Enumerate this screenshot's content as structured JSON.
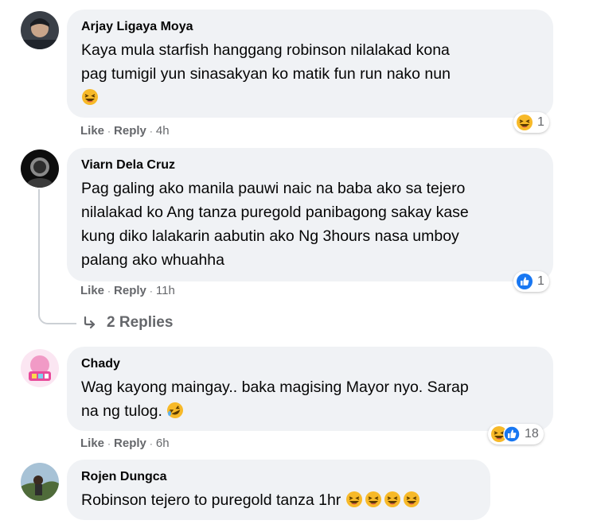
{
  "comments": [
    {
      "author": "Arjay Ligaya Moya",
      "text_lines": [
        "Kaya mula starfish hanggang robinson nilalakad kona",
        "pag tumigil yun sinasakyan ko matik fun run nako nun"
      ],
      "emoji": "laughing-emoji",
      "like_label": "Like",
      "reply_label": "Reply",
      "time": "4h",
      "reactions": [
        "haha"
      ],
      "reaction_count": "1"
    },
    {
      "author": "Viarn Dela Cruz",
      "text_lines": [
        "Pag galing ako manila pauwi naic na baba ako sa tejero",
        "nilalakad ko Ang tanza puregold panibagong sakay kase",
        "kung diko lalakarin aabutin ako Ng 3hours nasa umboy",
        "palang ako whuahha"
      ],
      "like_label": "Like",
      "reply_label": "Reply",
      "time": "11h",
      "reactions": [
        "like"
      ],
      "reaction_count": "1",
      "replies_label": "2 Replies"
    },
    {
      "author": "Chady",
      "text_lines": [
        "Wag kayong maingay.. baka magising Mayor nyo. Sarap",
        "na ng tulog."
      ],
      "emoji": "rofl-emoji",
      "like_label": "Like",
      "reply_label": "Reply",
      "time": "6h",
      "reactions": [
        "haha",
        "like"
      ],
      "reaction_count": "18"
    },
    {
      "author": "Rojen Dungca",
      "text_lines": [
        "Robinson tejero to puregold tanza 1hr"
      ],
      "emoji_count": 4
    }
  ],
  "sep": "·",
  "colors": {
    "bubble": "#f0f2f5",
    "meta": "#65676b",
    "like_blue": "#1877f2",
    "haha_yellow": "#f7b928"
  }
}
